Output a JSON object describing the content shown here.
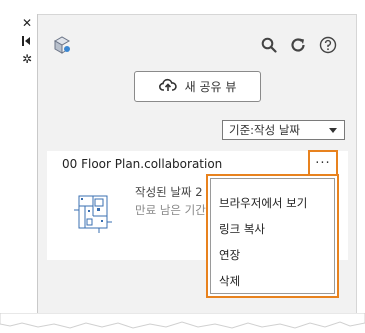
{
  "toolbar": {
    "new_share_label": "새 공유 뷰"
  },
  "sort": {
    "selected": "기준:작성 날짜"
  },
  "card": {
    "title": "00 Floor Plan.collaboration",
    "created_text": "작성된 날짜 2",
    "expiry_text": "만료 남은 기간",
    "more_label": "···"
  },
  "menu": {
    "items": [
      {
        "label": "브라우저에서 보기"
      },
      {
        "label": "링크 복사"
      },
      {
        "label": "연장"
      },
      {
        "label": "삭제"
      }
    ]
  },
  "colors": {
    "accent_highlight": "#e8821e",
    "panel_bg": "#f2f2f2"
  },
  "icons": [
    "close-icon",
    "collapse-icon",
    "settings-icon",
    "model-logo-icon",
    "search-icon",
    "refresh-icon",
    "help-icon",
    "cloud-upload-icon",
    "floor-plan-thumbnail"
  ]
}
